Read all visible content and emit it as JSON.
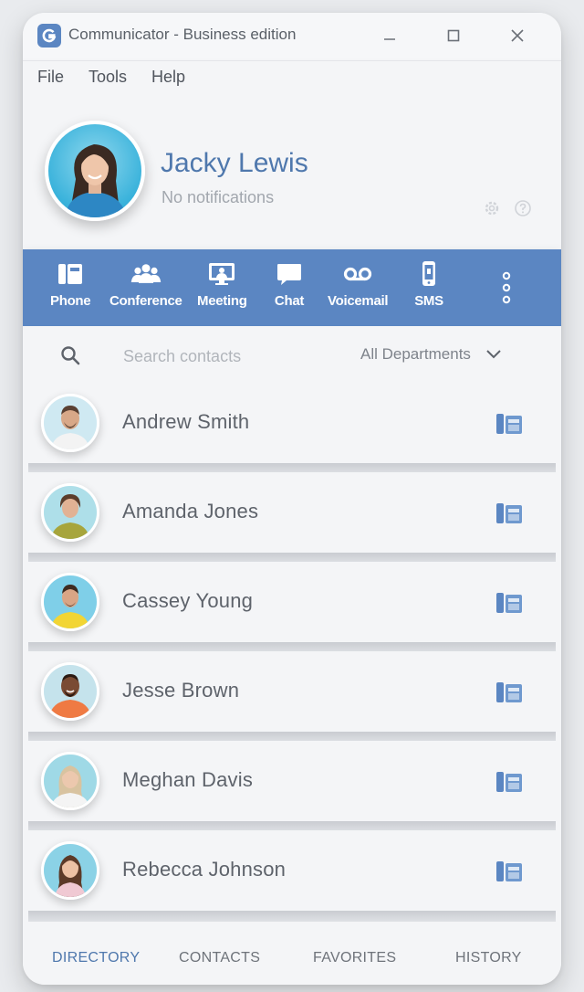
{
  "window": {
    "title": "Communicator - Business edition",
    "controls": [
      "minimize-icon",
      "maximize-icon",
      "close-icon"
    ]
  },
  "menu": {
    "items": [
      "File",
      "Tools",
      "Help"
    ]
  },
  "profile": {
    "name": "Jacky Lewis",
    "status": "No notifications",
    "icons": [
      "gear-icon",
      "help-icon"
    ]
  },
  "toolbar": {
    "items": [
      {
        "label": "Phone",
        "icon": "phone-icon"
      },
      {
        "label": "Conference",
        "icon": "conference-icon"
      },
      {
        "label": "Meeting",
        "icon": "meeting-icon"
      },
      {
        "label": "Chat",
        "icon": "chat-icon"
      },
      {
        "label": "Voicemail",
        "icon": "voicemail-icon"
      },
      {
        "label": "SMS",
        "icon": "sms-icon"
      }
    ],
    "more_icon": "more-vertical-icon"
  },
  "search": {
    "placeholder": "Search contacts",
    "value": "",
    "department": "All Departments"
  },
  "contacts": [
    {
      "name": "Andrew Smith"
    },
    {
      "name": "Amanda Jones"
    },
    {
      "name": "Cassey Young"
    },
    {
      "name": "Jesse Brown"
    },
    {
      "name": "Meghan Davis"
    },
    {
      "name": "Rebecca Johnson"
    }
  ],
  "tabs": {
    "items": [
      "DIRECTORY",
      "CONTACTS",
      "FAVORITES",
      "HISTORY"
    ],
    "active": "DIRECTORY"
  },
  "colors": {
    "accent": "#5b86c2",
    "name": "#4f78ad",
    "background": "#f4f5f7"
  }
}
